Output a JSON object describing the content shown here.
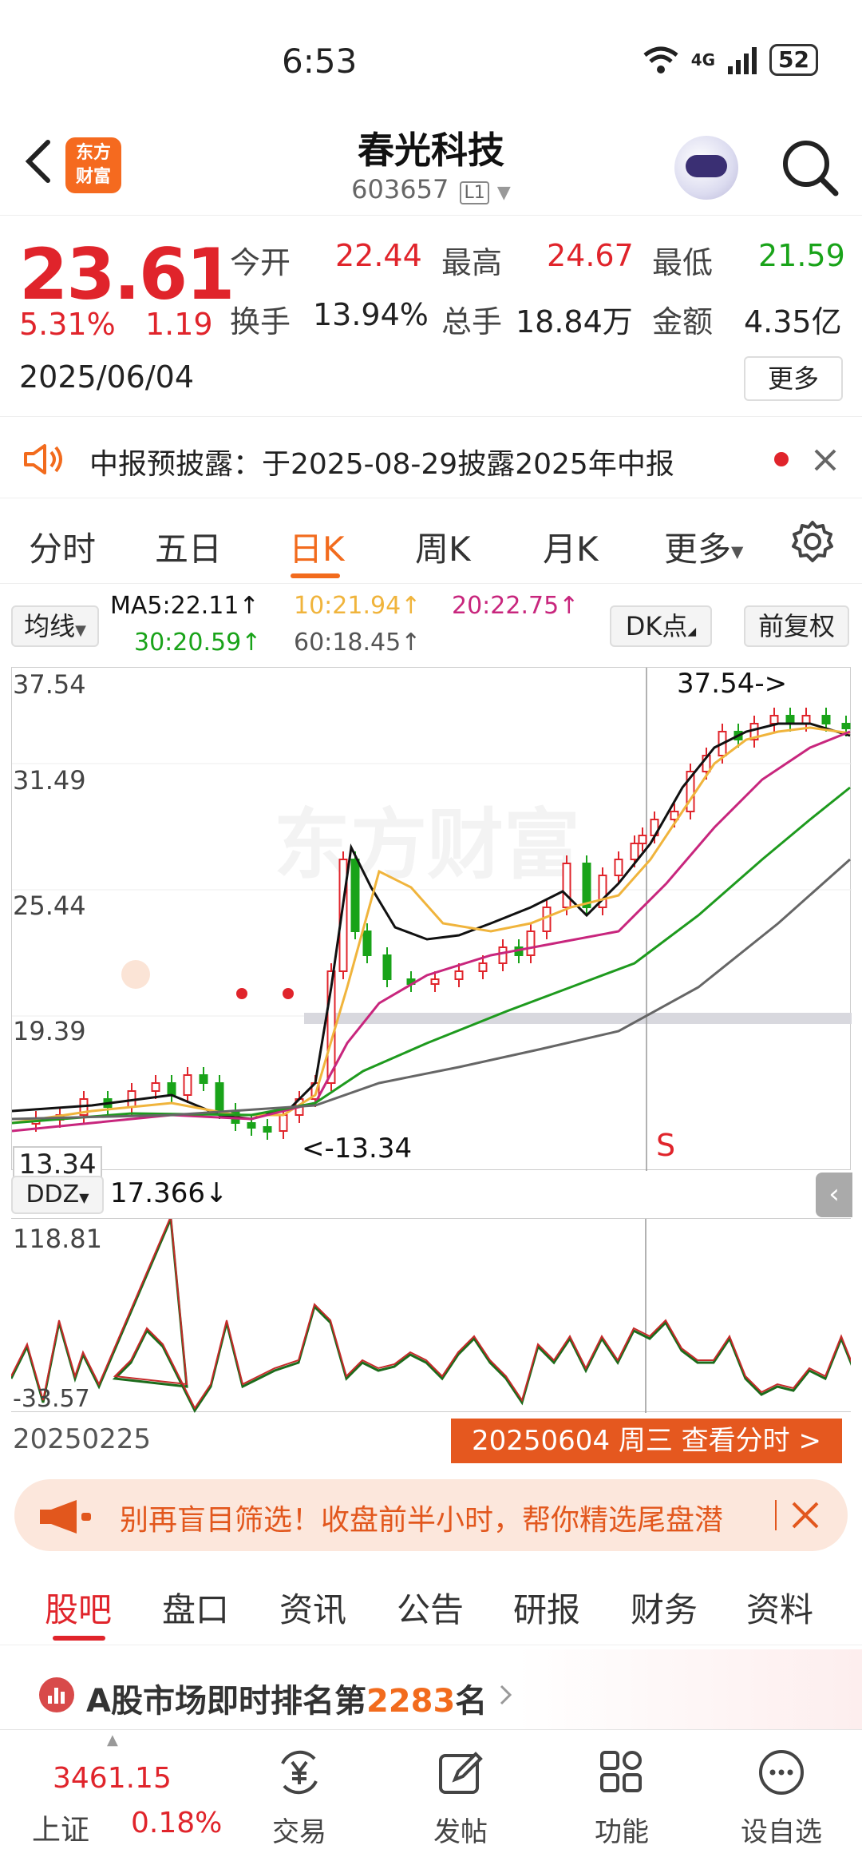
{
  "status_bar": {
    "time": "6:53",
    "network": "4G",
    "battery": "52"
  },
  "header": {
    "logo_line1": "东方",
    "logo_line2": "财富",
    "stock_name": "春光科技",
    "stock_code": "603657",
    "code_tag": "L1"
  },
  "quote": {
    "price": "23.61",
    "change_pct": "5.31%",
    "change_amt": "1.19",
    "date": "2025/06/04",
    "open_label": "今开",
    "open": "22.44",
    "high_label": "最高",
    "high": "24.67",
    "low_label": "最低",
    "low": "21.59",
    "turnover_label": "换手",
    "turnover": "13.94%",
    "volume_label": "总手",
    "volume": "18.84万",
    "amount_label": "金额",
    "amount": "4.35亿",
    "more_label": "更多"
  },
  "notice": {
    "text": "中报预披露：于2025-08-29披露2025年中报"
  },
  "period_tabs": {
    "items": [
      "分时",
      "五日",
      "日K",
      "周K",
      "月K",
      "更多"
    ],
    "active": "日K"
  },
  "indicators": {
    "ma_select": "均线",
    "ma5": "MA5:22.11↑",
    "ma10": "10:21.94↑",
    "ma20": "20:22.75↑",
    "ma30": "30:20.59↑",
    "ma60": "60:18.45↑",
    "dk_label": "DK点",
    "adjust_label": "前复权"
  },
  "chart_data": {
    "type": "candlestick",
    "y_ticks": [
      "37.54",
      "31.49",
      "25.44",
      "19.39"
    ],
    "ylim": [
      13.34,
      37.54
    ],
    "max_label": "37.54->",
    "min_label": "<-13.34",
    "current_left_label": "13.34",
    "signal_label": "S",
    "colors": {
      "up": "#e0242b",
      "down": "#19a319",
      "ma5": "#111111",
      "ma10": "#f0b43c",
      "ma20": "#c8267d",
      "ma30": "#1e9a1e",
      "ma60": "#666666"
    }
  },
  "sub_indicator": {
    "name": "DDZ",
    "value": "17.366↓",
    "max": "118.81",
    "min": "-33.57",
    "start_date": "20250225",
    "cursor_info": "20250604 周三 查看分时 >"
  },
  "banner": {
    "text": "别再盲目筛选！收盘前半小时，帮你精选尾盘潜"
  },
  "bottom_tabs": {
    "items": [
      "股吧",
      "盘口",
      "资讯",
      "公告",
      "研报",
      "财务",
      "资料"
    ],
    "active": "股吧"
  },
  "ranking": {
    "prefix": "A股市场即时排名第",
    "rank": "2283",
    "suffix": "名"
  },
  "bottom_nav": {
    "index_value": "3461.15",
    "index_name": "上证",
    "index_change": "0.18%",
    "trade": "交易",
    "post": "发帖",
    "functions": "功能",
    "watchlist": "设自选"
  }
}
